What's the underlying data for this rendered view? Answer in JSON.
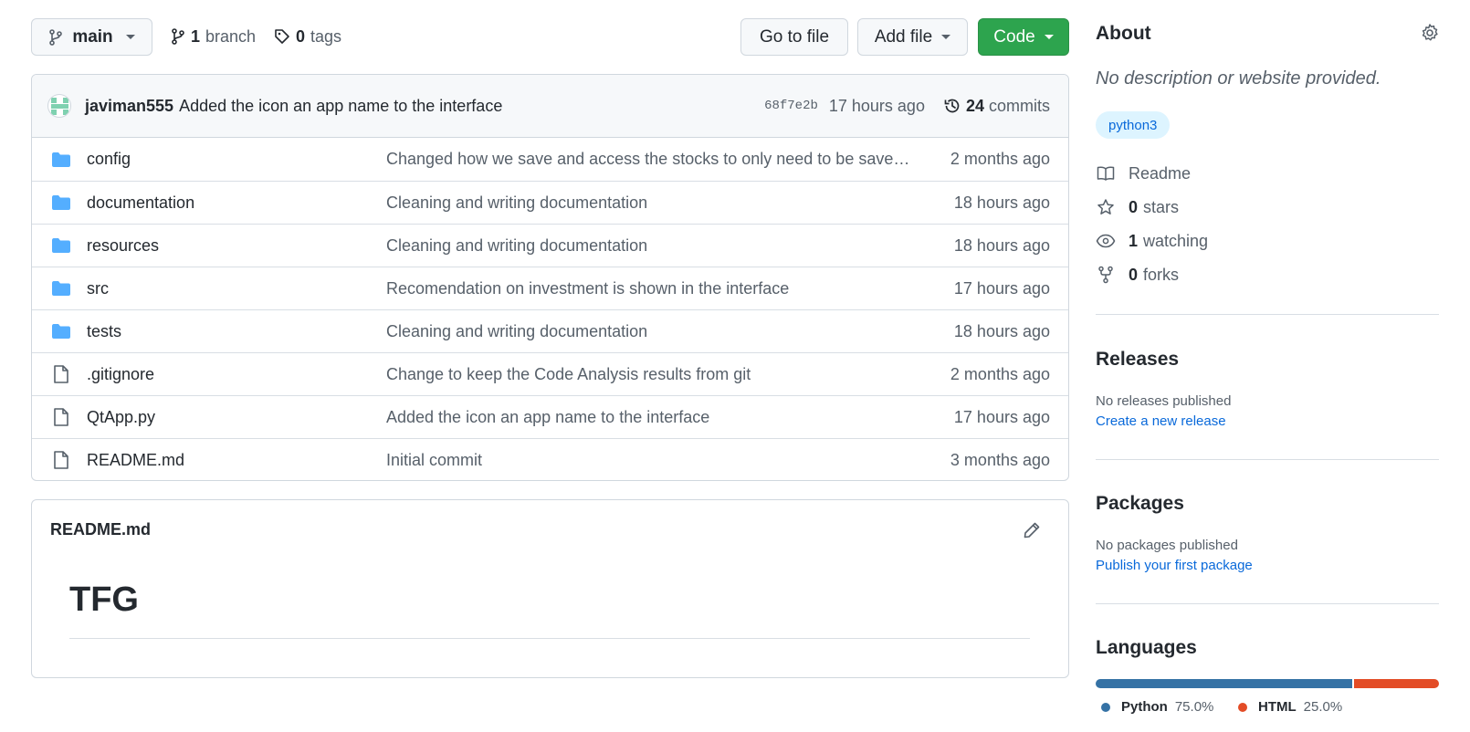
{
  "toolbar": {
    "branch_select": "main",
    "branches_count": "1",
    "branches_label": "branch",
    "tags_count": "0",
    "tags_label": "tags",
    "go_to_file": "Go to file",
    "add_file": "Add file",
    "code": "Code",
    "code_color": "#2da44e"
  },
  "commit": {
    "author": "javiman555",
    "message": "Added the icon an app name to the interface",
    "sha": "68f7e2b",
    "time": "17 hours ago",
    "count": "24",
    "count_label": "commits"
  },
  "files": [
    {
      "type": "folder",
      "name": "config",
      "message": "Changed how we save and access the stocks to only need to be saved at…",
      "age": "2 months ago"
    },
    {
      "type": "folder",
      "name": "documentation",
      "message": "Cleaning and writing documentation",
      "age": "18 hours ago"
    },
    {
      "type": "folder",
      "name": "resources",
      "message": "Cleaning and writing documentation",
      "age": "18 hours ago"
    },
    {
      "type": "folder",
      "name": "src",
      "message": "Recomendation on investment is shown in the interface",
      "age": "17 hours ago"
    },
    {
      "type": "folder",
      "name": "tests",
      "message": "Cleaning and writing documentation",
      "age": "18 hours ago"
    },
    {
      "type": "file",
      "name": ".gitignore",
      "message": "Change to keep the Code Analysis results from git",
      "age": "2 months ago"
    },
    {
      "type": "file",
      "name": "QtApp.py",
      "message": "Added the icon an app name to the interface",
      "age": "17 hours ago"
    },
    {
      "type": "file",
      "name": "README.md",
      "message": "Initial commit",
      "age": "3 months ago"
    }
  ],
  "readme": {
    "title": "README.md",
    "heading": "TFG"
  },
  "about": {
    "title": "About",
    "description": "No description or website provided.",
    "topic": "python3",
    "readme": "Readme",
    "stars_count": "0",
    "stars_label": "stars",
    "watching_count": "1",
    "watching_label": "watching",
    "forks_count": "0",
    "forks_label": "forks"
  },
  "releases": {
    "title": "Releases",
    "empty": "No releases published",
    "create": "Create a new release"
  },
  "packages": {
    "title": "Packages",
    "empty": "No packages published",
    "publish": "Publish your first package"
  },
  "languages": {
    "title": "Languages",
    "items": [
      {
        "name": "Python",
        "percent": "75.0%",
        "value": 75.0,
        "color": "#3572a5"
      },
      {
        "name": "HTML",
        "percent": "25.0%",
        "value": 25.0,
        "color": "#e34c26"
      }
    ]
  }
}
